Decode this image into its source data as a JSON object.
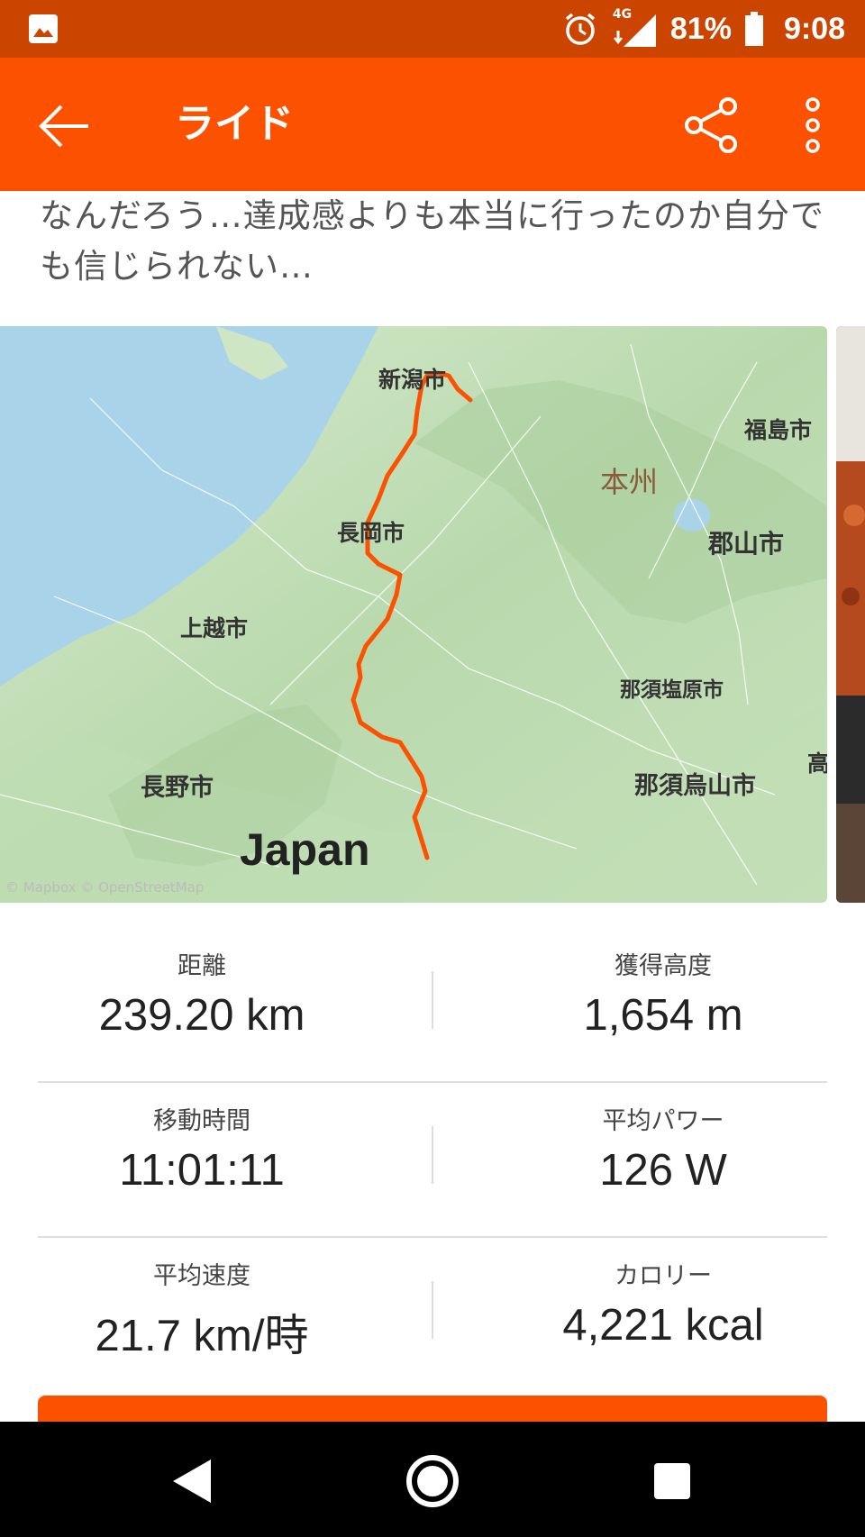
{
  "status_bar": {
    "network": "4G",
    "battery": "81%",
    "time": "9:08",
    "icons": [
      "gallery-icon",
      "alarm-icon",
      "signal-icon",
      "battery-icon"
    ]
  },
  "app_bar": {
    "title": "ライド",
    "icons": [
      "back-arrow-icon",
      "share-icon",
      "more-vert-icon"
    ]
  },
  "description": "なんだろう…達成感よりも本当に行ったのか自分でも信じられない…",
  "map": {
    "labels": {
      "niigata": "新潟市",
      "fukushima": "福島市",
      "honshu": "本州",
      "nagaoka": "長岡市",
      "koriyama": "郡山市",
      "joetsu": "上越市",
      "nasushiobara": "那須塩原市",
      "nagano": "長野市",
      "nasukarasuyama": "那須烏山市",
      "taka": "高",
      "japan": "Japan"
    },
    "credit": "© Mapbox © OpenStreetMap",
    "route_color": "#fc5200"
  },
  "stats": {
    "distance": {
      "label": "距離",
      "value": "239.20 km"
    },
    "elevation": {
      "label": "獲得高度",
      "value": "1,654 m"
    },
    "moving_time": {
      "label": "移動時間",
      "value": "11:01:11"
    },
    "avg_power": {
      "label": "平均パワー",
      "value": "126 W"
    },
    "avg_speed": {
      "label": "平均速度",
      "value": "21.7 km/時"
    },
    "calories": {
      "label": "カロリー",
      "value": "4,221 kcal"
    }
  },
  "nav_bar": {
    "icons": [
      "back-triangle-icon",
      "home-circle-icon",
      "recents-square-icon"
    ]
  },
  "colors": {
    "status_bar": "#cc4500",
    "app_bar": "#fc5200",
    "accent": "#fc5200"
  }
}
